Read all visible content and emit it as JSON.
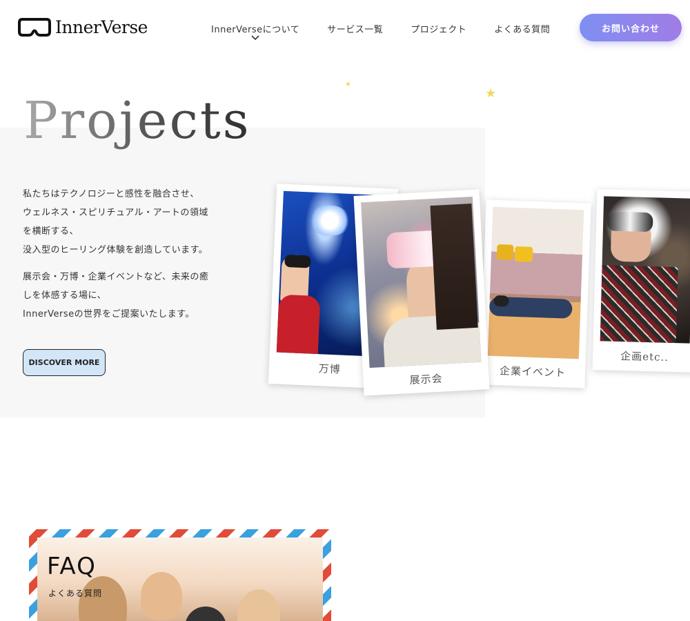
{
  "header": {
    "logo_text": "InnerVerse",
    "nav": [
      {
        "label": "InnerVerseについて",
        "has_dropdown": true
      },
      {
        "label": "サービス一覧"
      },
      {
        "label": "プロジェクト"
      },
      {
        "label": "よくある質問"
      }
    ],
    "contact_label": "お問い合わせ"
  },
  "hero": {
    "title": "Projects",
    "paragraph1": "私たちはテクノロジーと感性を融合させ、\nウェルネス・スピリチュアル・アートの領域\nを横断する、\n没入型のヒーリング体験を創造しています。",
    "paragraph2": "展示会・万博・企業イベントなど、未来の癒\nしを体感する場に、\nInnerVerseの世界をご提案いたします。",
    "cta_label": "DISCOVER MORE"
  },
  "projects": [
    {
      "caption": "万博"
    },
    {
      "caption": "展示会"
    },
    {
      "caption": "企業イベント"
    },
    {
      "caption": "企画etc.."
    }
  ],
  "faq": {
    "title": "FAQ",
    "subtitle": "よくある質問"
  },
  "colors": {
    "accent_gradient_start": "#7f8ff2",
    "accent_gradient_end": "#a07ce6",
    "cta_bg": "#d3e6f8",
    "star": "#f2d85a",
    "airmail_red": "#e04b3a",
    "airmail_blue": "#3aa0e0"
  },
  "icons": {
    "logo": "vr-goggles-icon",
    "dropdown": "chevron-down-icon",
    "decor": "star-icon"
  }
}
